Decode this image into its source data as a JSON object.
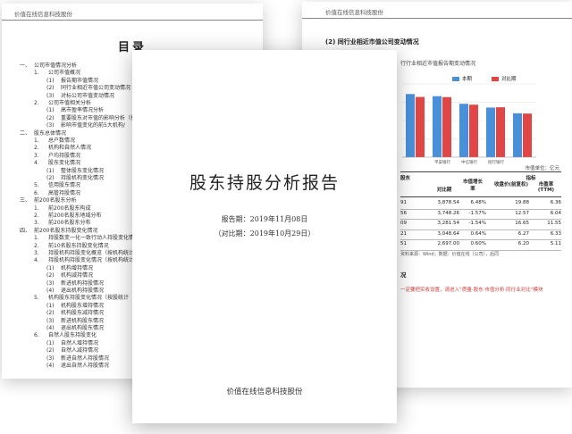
{
  "toc_page": {
    "header": "价值在线信息科技股份",
    "title": "目录",
    "rows": [
      {
        "num": "一、",
        "text": "公司市值情况分析",
        "indent": 0
      },
      {
        "num": "1.",
        "text": "公司市值概况",
        "indent": 1
      },
      {
        "num": "(1)",
        "text": "报告期市值情况",
        "indent": 2
      },
      {
        "num": "(2)",
        "text": "同行业相近市值公司变动情况",
        "indent": 2
      },
      {
        "num": "(3)",
        "text": "对标公司市值变动情况",
        "indent": 2
      },
      {
        "num": "2.",
        "text": "公司市值相关分析",
        "indent": 1
      },
      {
        "num": "(1)",
        "text": "高市盈率情况分析",
        "indent": 2
      },
      {
        "num": "(2)",
        "text": "重要股东对市值的影响分析（控",
        "indent": 2
      },
      {
        "num": "(3)",
        "text": "影响市值变化的前5大机构/",
        "indent": 2
      },
      {
        "num": "二、",
        "text": "股东总体情况",
        "indent": 0
      },
      {
        "num": "1.",
        "text": "总户数情况",
        "indent": 1
      },
      {
        "num": "2.",
        "text": "机构和自然人情况",
        "indent": 1
      },
      {
        "num": "3.",
        "text": "户均持股情况",
        "indent": 1
      },
      {
        "num": "4.",
        "text": "股东变化情况",
        "indent": 1
      },
      {
        "num": "(1)",
        "text": "整体股东变化情况",
        "indent": 2
      },
      {
        "num": "(2)",
        "text": "持股机构变化情况",
        "indent": 2
      },
      {
        "num": "5.",
        "text": "信用股东情况",
        "indent": 1
      },
      {
        "num": "6.",
        "text": "高管持股情况",
        "indent": 1
      },
      {
        "num": "三、",
        "text": "前200名股东分析",
        "indent": 0
      },
      {
        "num": "1.",
        "text": "前200名股东构成",
        "indent": 1
      },
      {
        "num": "2.",
        "text": "前200名股东地域分布",
        "indent": 1
      },
      {
        "num": "3.",
        "text": "前200名股东分布",
        "indent": 1
      },
      {
        "num": "四、",
        "text": "前200名股东持股变化情况",
        "indent": 0
      },
      {
        "num": "1.",
        "text": "持股数变一化一致行动人持股变化情况",
        "indent": 1
      },
      {
        "num": "2.",
        "text": "前10名股东持股变化情况",
        "indent": 1
      },
      {
        "num": "3.",
        "text": "持股机构持股变化概览（按机构统计",
        "indent": 1
      },
      {
        "num": "4.",
        "text": "持股机构持股变化情况（按机构统计",
        "indent": 1
      },
      {
        "num": "(1)",
        "text": "机构增持情况",
        "indent": 2
      },
      {
        "num": "(2)",
        "text": "机构减持情况",
        "indent": 2
      },
      {
        "num": "(3)",
        "text": "新进机构持股情况",
        "indent": 2
      },
      {
        "num": "(4)",
        "text": "退出机构持股情况",
        "indent": 2
      },
      {
        "num": "5.",
        "text": "机构股东持股变化情况（按股统计",
        "indent": 1
      },
      {
        "num": "(1)",
        "text": "机构股东增持情况",
        "indent": 2
      },
      {
        "num": "(2)",
        "text": "机构股东减持情况",
        "indent": 2
      },
      {
        "num": "(3)",
        "text": "新进机构股东情况",
        "indent": 2
      },
      {
        "num": "(4)",
        "text": "退出机构股东情况",
        "indent": 2
      },
      {
        "num": "6.",
        "text": "自然人股东持股变化",
        "indent": 1
      },
      {
        "num": "(1)",
        "text": "自然人增持情况",
        "indent": 2
      },
      {
        "num": "(2)",
        "text": "自然人减持情况",
        "indent": 2
      },
      {
        "num": "(3)",
        "text": "新进自然人持股情况",
        "indent": 2
      },
      {
        "num": "(4)",
        "text": "退出自然人持股情况",
        "indent": 2
      }
    ]
  },
  "right_page": {
    "header": "价值在线信息科技股份",
    "heading": "(2) 同行业相近市值公司变动情况",
    "chart_title": "行行业相近市值报告期变动情况",
    "table_unit": "市值单位：亿元",
    "col_headers": [
      "股本",
      "对比期",
      "市值增长率",
      "收盘价(前复权)",
      "市盈率(TTM)"
    ],
    "group_header": "指标",
    "left_header_fragment": "股东",
    "source": "资料来源：Wind；数据：价值在线（公司），后同",
    "section2": "况",
    "note": "一定要把实收设置，请进入“质量·股东·市值分析·同行业对比”模块",
    "rows": [
      {
        "left": "91",
        "cmp": "3,878.54",
        "growth": "6.48%",
        "close": "19.88",
        "pe": "6.36"
      },
      {
        "left": "56",
        "cmp": "3,748.26",
        "growth": "-1.57%",
        "close": "12.57",
        "pe": "6.04"
      },
      {
        "left": "09",
        "cmp": "3,281.54",
        "growth": "-1.54%",
        "close": "16.65",
        "pe": "11.55"
      },
      {
        "left": "21",
        "cmp": "3,048.64",
        "growth": "0.64%",
        "close": "6.27",
        "pe": "6.33"
      },
      {
        "left": "51",
        "cmp": "2,697.00",
        "growth": "0.60%",
        "close": "6.20",
        "pe": "5.11"
      }
    ]
  },
  "cover": {
    "title": "股东持股分析报告",
    "report_date": "报告期：2019年11月08日",
    "compare_date": "（对比期：2019年10月29日）",
    "company": "价值在线信息科技股份"
  },
  "chart_data": {
    "type": "bar",
    "title": "行行业相近市值报告期变动情况",
    "categories": [
      "",
      "平安银行",
      "中信银行",
      "招行银行",
      "",
      "民生银行"
    ],
    "series": [
      {
        "name": "本期",
        "color": "#4a90d9",
        "values": [
          3878,
          3748,
          3281,
          3048,
          2697
        ]
      },
      {
        "name": "对比期",
        "color": "#e04646",
        "values": [
          3700,
          3690,
          3225,
          3066,
          2680
        ]
      }
    ],
    "legend": "top-right",
    "ylim": [
      0,
      4500
    ],
    "grid": true
  }
}
